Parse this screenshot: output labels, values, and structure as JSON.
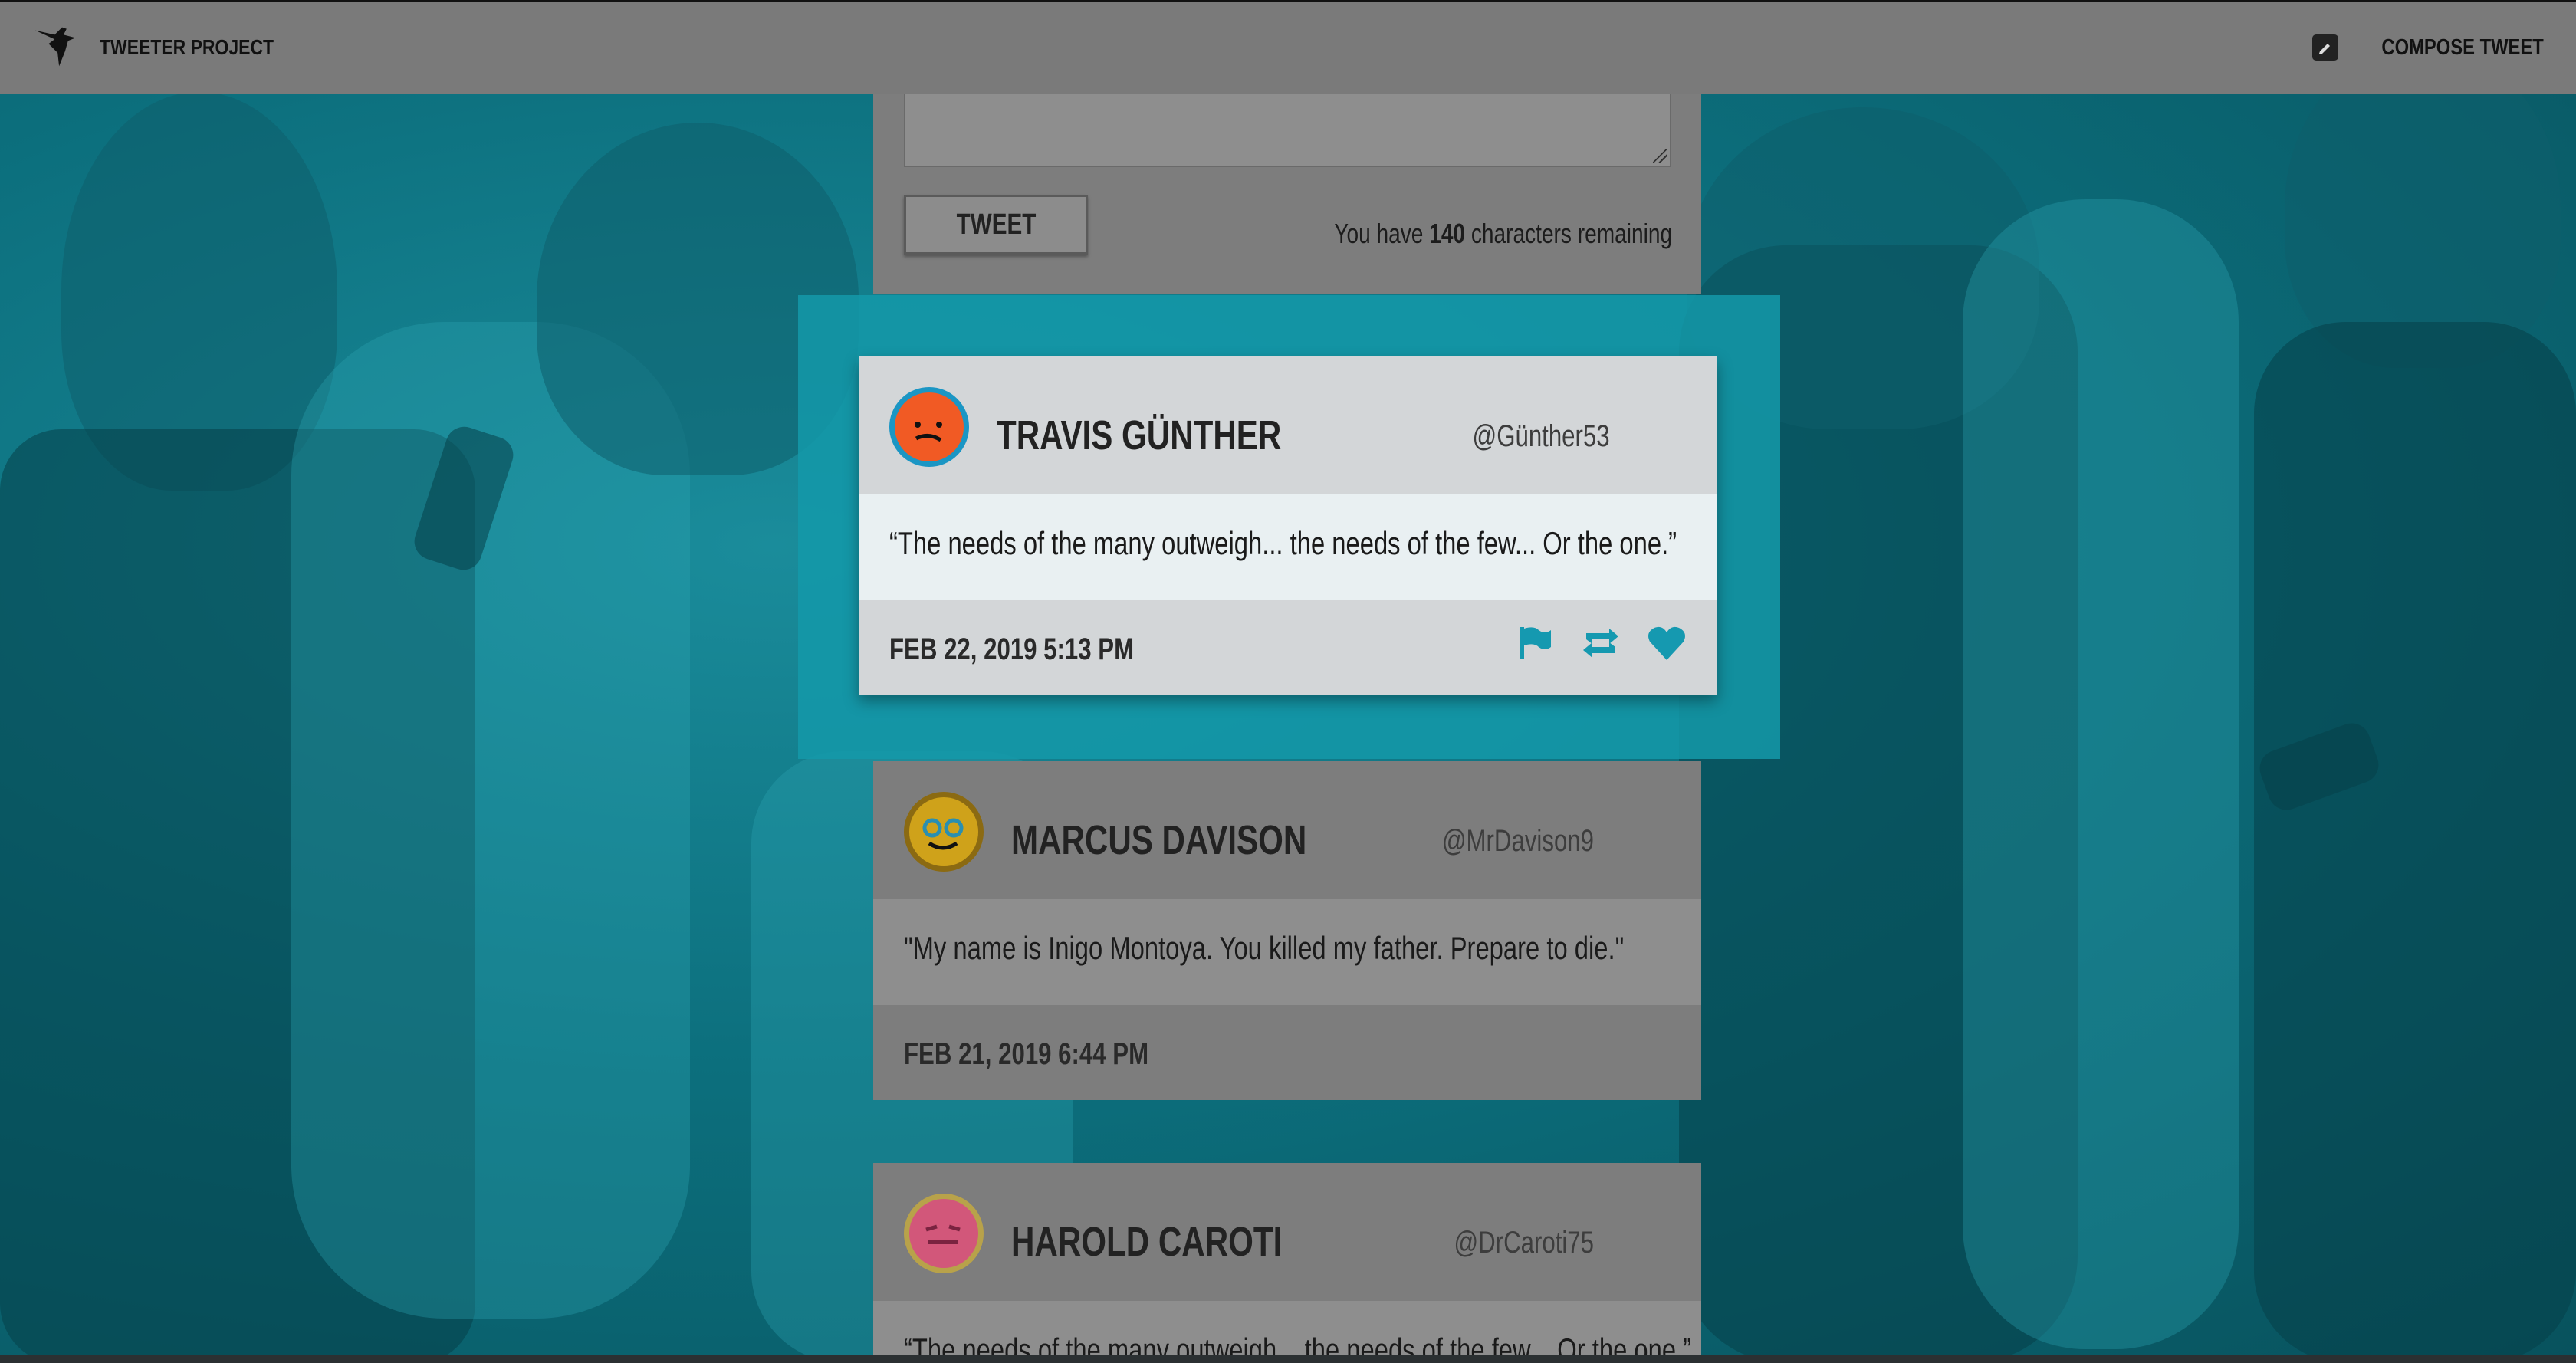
{
  "navbar": {
    "brand_label": "TWEETER PROJECT",
    "compose_label": "COMPOSE TWEET",
    "brand_icon": "hummingbird-icon",
    "compose_icon": "edit-icon"
  },
  "composer": {
    "tweet_button_label": "TWEET",
    "counter_prefix": "You have ",
    "counter_value": "140",
    "counter_suffix": " characters remaining"
  },
  "tweets": [
    {
      "name": "TRAVIS GÜNTHER",
      "handle": "@Günther53",
      "text": "“The needs of the many outweigh... the needs of the few... Or the one.”",
      "date": "FEB 22, 2019 5:13 PM",
      "actions": [
        "flag-icon",
        "retweet-icon",
        "heart-icon"
      ]
    },
    {
      "name": "MARCUS DAVISON",
      "handle": "@MrDavison9",
      "text": "\"My name is Inigo Montoya. You killed my father. Prepare to die.\"",
      "date": "FEB 21, 2019 6:44 PM"
    },
    {
      "name": "HAROLD CAROTI",
      "handle": "@DrCaroti75",
      "text": "“The needs of the many outweigh... the needs of the few... Or the one.”"
    }
  ],
  "colors": {
    "accent": "#1499a9",
    "navbar": "#7a7a7a",
    "active_avatar_ring": "#1b96c4"
  }
}
